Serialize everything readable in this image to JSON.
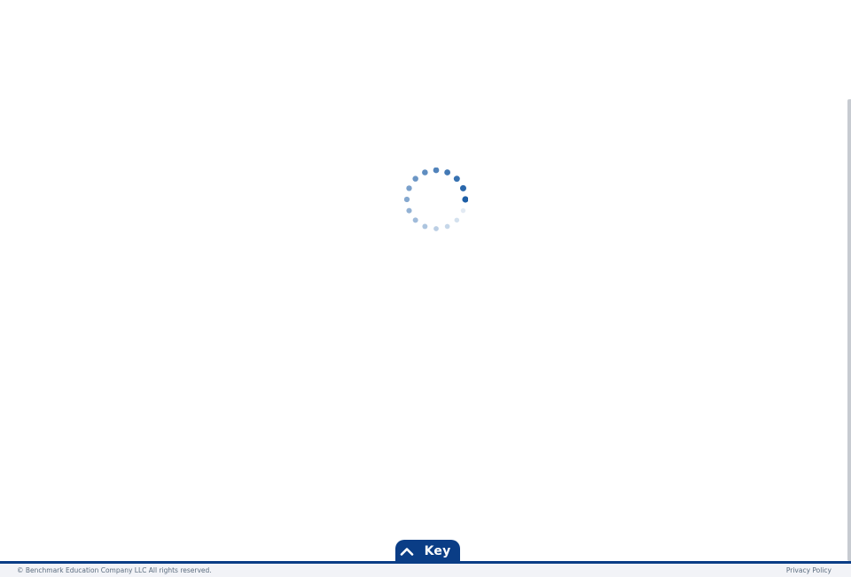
{
  "loading": {
    "indicator": "spinner-icon",
    "color": "#1d5ea6"
  },
  "key_panel": {
    "label": "Key",
    "icon": "chevron-up-icon",
    "background": "#0a3d86"
  },
  "footer": {
    "copyright": "© Benchmark Education Company LLC All rights reserved.",
    "privacy_link": "Privacy Policy",
    "accent": "#0a3d86"
  }
}
